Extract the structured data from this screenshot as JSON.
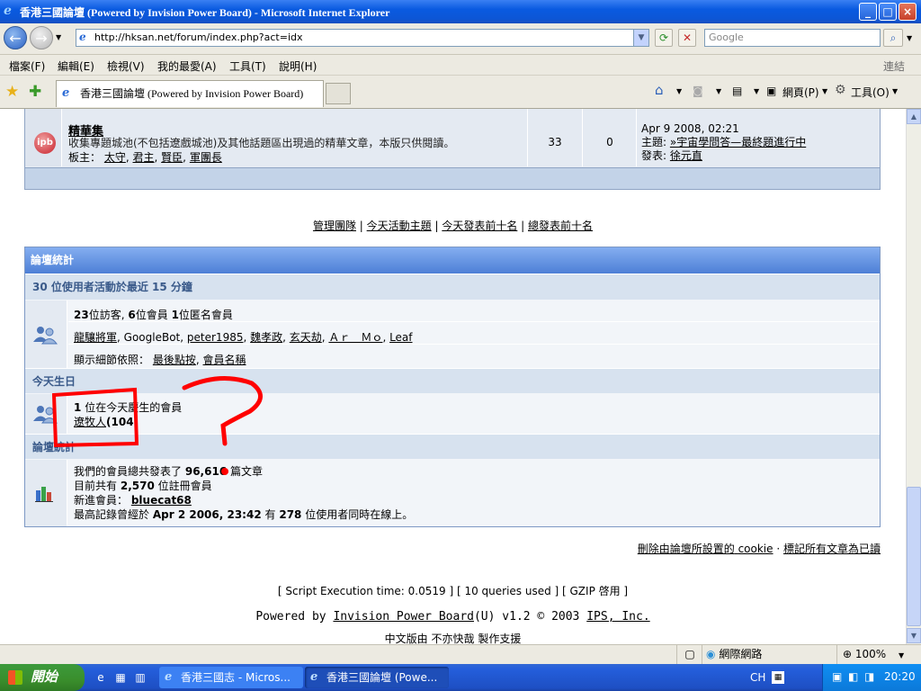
{
  "window": {
    "title": "香港三國論壇 (Powered by Invision Power Board) - Microsoft Internet Explorer",
    "minimize": "_",
    "maximize": "□",
    "close": "×"
  },
  "address": {
    "url": "http://hksan.net/forum/index.php?act=idx",
    "search_placeholder": "Google"
  },
  "menu": {
    "items": [
      "檔案(F)",
      "編輯(E)",
      "檢視(V)",
      "我的最愛(A)",
      "工具(T)",
      "說明(H)"
    ],
    "links_label": "連結"
  },
  "tabbar": {
    "tab_title": "香港三國論壇 (Powered by Invision Power Board)",
    "page_label": "網頁(P)",
    "tools_label": "工具(O)"
  },
  "forum_row": {
    "icon_text": "ipb",
    "title": "精華集",
    "description": "收集專題城池(不包括遼戲城池)及其他話題區出現過的精華文章，本版只供閱讀。",
    "mods_label": "板主：",
    "mods": [
      "太守",
      "君主",
      "賢臣",
      "軍團長"
    ],
    "topics": "33",
    "replies": "0",
    "last_date": "Apr 9 2008, 02:21",
    "last_topic_label": "主題:",
    "last_topic": "»宇宙學問答—最終題進行中",
    "last_by_label": "發表:",
    "last_by": "徐元直"
  },
  "top_links": [
    "管理團隊",
    "今天活動主題",
    "今天發表前十名",
    "總發表前十名"
  ],
  "stats": {
    "header": "論壇統計",
    "active_header": "30 位使用者活動於最近  15 分鐘",
    "active_guests": "23",
    "active_guests_label": "位訪客,",
    "active_members": "6",
    "active_members_label": "位會員",
    "active_anon": "1",
    "active_anon_label": "位匿名會員",
    "active_users": [
      "龍驤將軍",
      "GoogleBot",
      "peter1985",
      "魏孝政",
      "玄天劫",
      "Ａｒ　Ｍｏ",
      "Leaf"
    ],
    "sort_label": "顯示細節依照：",
    "sort_options": [
      "最後點按",
      "會員名稱"
    ],
    "birthday_header": "今天生日",
    "birthday_count": "1",
    "birthday_label": "位在今天慶生的會員",
    "birthday_member": "遼牧人",
    "birthday_age": "(104)",
    "board_header": "論壇統計",
    "posts_prefix": "我們的會員總共發表了",
    "posts_total": "96,616",
    "posts_suffix": "篇文章",
    "members_prefix": "目前共有",
    "members_total": "2,570",
    "members_suffix": "位註冊會員",
    "newest_label": "新進會員：",
    "newest_member": "bluecat68",
    "record_prefix": "最高記錄曾經於",
    "record_date": "Apr 2 2006, 23:42",
    "record_mid": "有",
    "record_count": "278",
    "record_suffix": "位使用者同時在線上。"
  },
  "cookie_links": {
    "delete_cookie_prefix": "刪除由論壇所設置的",
    "delete_cookie_word": "cookie",
    "mark_read": "標記所有文章為已讀"
  },
  "footer": {
    "exec": "[ Script Execution time: 0.0519 ]   [ 10 queries used ]   [ GZIP 啓用 ]",
    "powered_prefix": "Powered by",
    "powered_link": "Invision Power Board",
    "powered_mid": "(U) v1.2 © 2003",
    "ips_link": "IPS, Inc.",
    "chinese_prefix": "中文版由",
    "chinese_name": "不亦快哉",
    "chinese_suffix": "製作支援"
  },
  "statusbar": {
    "zone": "網際網路",
    "zoom": "100%"
  },
  "taskbar": {
    "start": "開始",
    "tasks": [
      "香港三國志 - Micros...",
      "香港三國論壇 (Powe..."
    ],
    "lang": "CH",
    "clock": "20:20"
  },
  "colors": {
    "annotation": "#ff0000",
    "stats_header": "#5b8ad9",
    "subheader_text": "#3a5a8a"
  }
}
